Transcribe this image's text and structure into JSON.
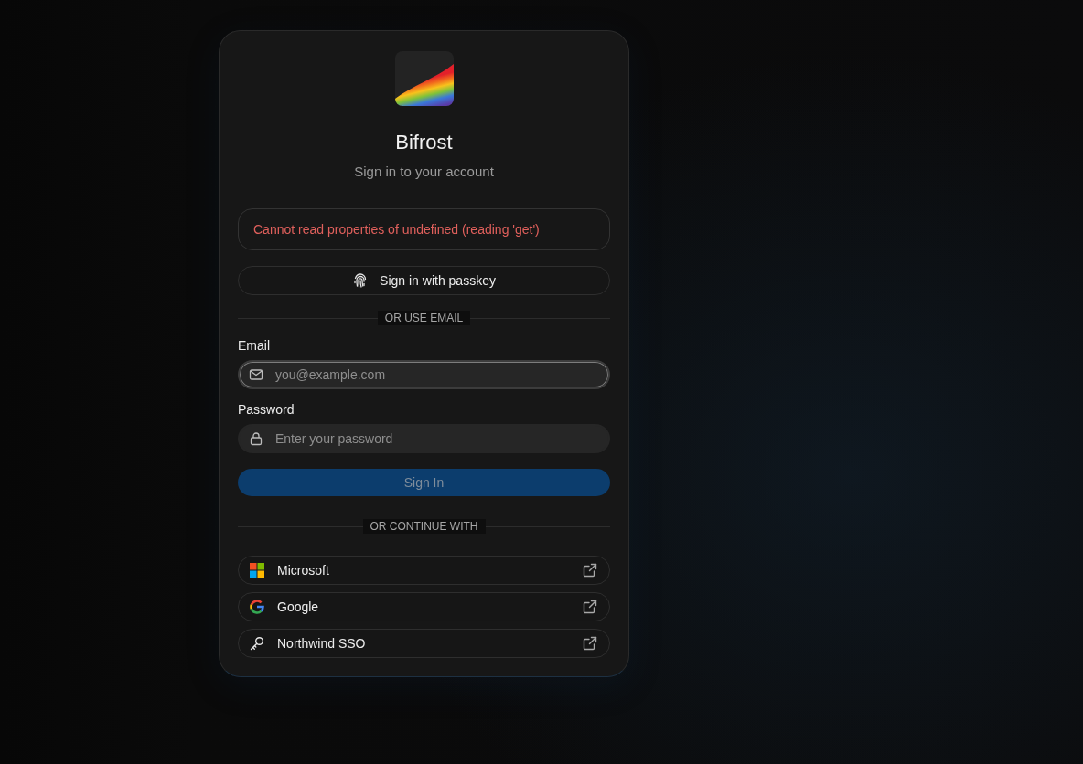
{
  "app": {
    "name": "Bifrost",
    "subtitle": "Sign in to your account"
  },
  "error": {
    "message": "Cannot read properties of undefined (reading 'get')"
  },
  "passkey_button": {
    "label": "Sign in with passkey"
  },
  "email_divider": {
    "label": "OR USE EMAIL"
  },
  "fields": [
    {
      "kind": "email",
      "label": "Email",
      "placeholder": "you@example.com",
      "focused": true
    },
    {
      "kind": "password",
      "label": "Password",
      "placeholder": "Enter your password",
      "focused": false
    }
  ],
  "submit_button": {
    "label": "Sign In",
    "disabled": true
  },
  "providers_divider": {
    "label": "OR CONTINUE WITH"
  },
  "providers": [
    {
      "kind": "microsoft",
      "label": "Microsoft"
    },
    {
      "kind": "google",
      "label": "Google"
    },
    {
      "kind": "key",
      "label": "Northwind SSO"
    }
  ]
}
